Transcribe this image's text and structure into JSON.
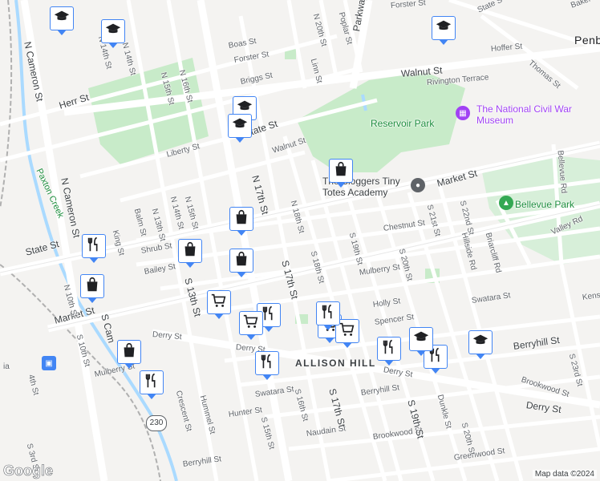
{
  "colors": {
    "background": "#f4f3f1",
    "park": "#c8ebc9",
    "road": "#ffffff",
    "highway": "#fde293",
    "water": "#aadaff",
    "rail": "#b0b0b0",
    "pin_border": "#4285f4",
    "museum": "#a142f4",
    "park_label": "#1e8e3e"
  },
  "labels": {
    "n_cameron_st": "N Cameron St",
    "n_cameron_st_2": "N Cameron St",
    "paxton_creek": "Paxton Creek",
    "herr_st": "Herr St",
    "state_st": "State St",
    "state_st_2": "State St",
    "market_st_w": "Market St",
    "market_st_e": "Market St",
    "walnut_st_w": "Walnut St",
    "walnut_st_e": "Walnut St",
    "forster_st": "Forster St",
    "forster_st_2": "Forster St",
    "boas_st": "Boas St",
    "briggs_st": "Briggs St",
    "liberty_st": "Liberty St",
    "hoffer_st": "Hoffer St",
    "thomas_st": "Thomas St",
    "baker_st": "Baker S",
    "state_st_ne": "State S",
    "rivington_terrace": "Rivington Terrace",
    "reservoir_park": "Reservoir Park",
    "museum": "The National Civil War Museum",
    "academy": "The Bloggers Tiny Totes Academy",
    "bellevue_park": "Bellevue Park",
    "bellevue_rd": "Bellevue Rd",
    "hillside_rd": "Hillside Rd",
    "briarcliff_rd": "Briarcliff Rd",
    "valley_rd": "Valley Rd",
    "chestnut_st": "Chestnut St",
    "mulberry_st": "Mulberry St",
    "mulberry_st_2": "Mulberry St",
    "holly_st": "Holly St",
    "spencer_st": "Spencer St",
    "swatara_st": "Swatara St",
    "swatara_st_2": "Swatara St",
    "berryhill_st": "Berryhill St",
    "berryhill_st_2": "Berryhill St",
    "berryhill_st_3": "Berryhill St",
    "derry_st": "Derry St",
    "derry_st_2": "Derry St",
    "derry_st_3": "Derry St",
    "derry_st_4": "Derry St",
    "brookwood_st": "Brookwood St",
    "brookwood_st_2": "Brookwood St",
    "greenwood_st": "Greenwood St",
    "naudain_st": "Naudain St",
    "hunter_st": "Hunter St",
    "kensington": "Kens",
    "allison_hill": "ALLISON HILL",
    "penbrook": "Penb",
    "n_17th_st": "N 17th St",
    "s_17th_st": "S 17th St",
    "s_17th_st_2": "S 17th St",
    "n_18th_st": "N 18th St",
    "s_18th_st": "S 18th St",
    "s_19th_st": "S 19th St",
    "s_19th_st_2": "S 19th St",
    "s_20th_st": "S 20th St",
    "s_20th_st_2": "S 20th St",
    "s_21st_st": "S 21st St",
    "s_22nd_st": "S 22nd St",
    "s_23rd_st": "S 23rd St",
    "n_20th_st": "N 20th St",
    "linn_st": "Linn St",
    "poplar_st": "Poplar St",
    "parkway_dr": "Parkway Dr",
    "n_16th_st": "N 16th St",
    "s_16th_st": "S 16th St",
    "n_15th_st": "N 15th St",
    "n_15th_st_2": "N 15th St",
    "s_15th_st": "S 15th St",
    "n_14th_st": "N 14th St",
    "n_14th_st_2": "N 14th St",
    "n_14th_st_3": "N 14th St",
    "n_13th_st": "N 13th St",
    "s_13th_st": "S 13th St",
    "n_10th_st": "N 10th St",
    "s_10th_st": "S 10th St",
    "s_cameron": "S Cam",
    "s_3rd_st": "S 3rd St",
    "s_4th_st": "4th St",
    "balm_st": "Balm St",
    "king_st": "King St",
    "shrub_st": "Shrub St",
    "bailey_st": "Bailey St",
    "crescent_st": "Crescent St",
    "hummel_st": "Hummel St",
    "dunkle_st": "Dunkle St",
    "route_230": "230",
    "attribution": "Map data ©2024",
    "google": "Google",
    "ia": "ia"
  },
  "pins": [
    {
      "type": "school",
      "icon": "graduation-cap-icon"
    },
    {
      "type": "school",
      "icon": "graduation-cap-icon"
    },
    {
      "type": "school",
      "icon": "graduation-cap-icon"
    },
    {
      "type": "school",
      "icon": "graduation-cap-icon"
    },
    {
      "type": "school",
      "icon": "graduation-cap-icon"
    },
    {
      "type": "shopping",
      "icon": "shopping-bag-icon"
    },
    {
      "type": "shopping",
      "icon": "shopping-bag-icon"
    },
    {
      "type": "shopping",
      "icon": "shopping-bag-icon"
    },
    {
      "type": "shopping",
      "icon": "shopping-bag-icon"
    },
    {
      "type": "shopping",
      "icon": "shopping-bag-icon"
    },
    {
      "type": "shopping",
      "icon": "shopping-bag-icon"
    },
    {
      "type": "restaurant",
      "icon": "fork-knife-icon"
    },
    {
      "type": "restaurant",
      "icon": "fork-knife-icon"
    },
    {
      "type": "restaurant",
      "icon": "fork-knife-icon"
    },
    {
      "type": "restaurant",
      "icon": "fork-knife-icon"
    },
    {
      "type": "restaurant",
      "icon": "fork-knife-icon"
    },
    {
      "type": "grocery",
      "icon": "shopping-cart-icon"
    },
    {
      "type": "grocery",
      "icon": "shopping-cart-icon"
    },
    {
      "type": "grocery",
      "icon": "shopping-cart-icon"
    },
    {
      "type": "grocery",
      "icon": "shopping-cart-icon"
    },
    {
      "type": "school",
      "icon": "graduation-cap-icon"
    },
    {
      "type": "school",
      "icon": "graduation-cap-icon"
    },
    {
      "type": "restaurant",
      "icon": "fork-knife-icon"
    },
    {
      "type": "restaurant",
      "icon": "fork-knife-icon"
    }
  ]
}
